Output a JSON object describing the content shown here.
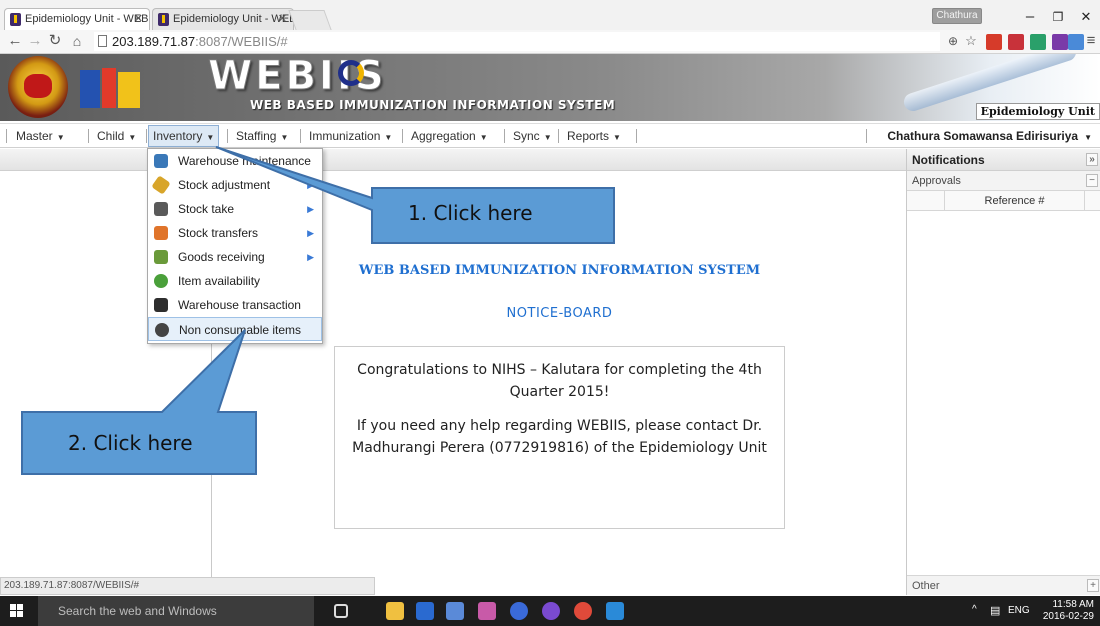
{
  "browser": {
    "tabs": [
      {
        "label": "Epidemiology Unit - WEBII"
      },
      {
        "label": "Epidemiology Unit - WEBI"
      }
    ],
    "user_chip": "Chathura",
    "window_controls": {
      "minimize": "–",
      "maximize": "❐",
      "close": "✕"
    },
    "address": {
      "host": "203.189.71.87",
      "rest": ":8087/WEBIIS/#"
    },
    "status_url": "203.189.71.87:8087/WEBIIS/#"
  },
  "header": {
    "title": "WEBIIS",
    "subtitle": "WEB BASED IMMUNIZATION INFORMATION SYSTEM",
    "unit_label": "Epidemiology Unit"
  },
  "menu": {
    "items": [
      {
        "label": "Master"
      },
      {
        "label": "Child"
      },
      {
        "label": "Inventory"
      },
      {
        "label": "Staffing"
      },
      {
        "label": "Immunization"
      },
      {
        "label": "Aggregation"
      },
      {
        "label": "Sync"
      },
      {
        "label": "Reports"
      }
    ],
    "user": "Chathura Somawansa Edirisuriya"
  },
  "inventory_dropdown": {
    "items": [
      {
        "label": "Warehouse maintenance",
        "icon": "warehouse-icon",
        "color": "#3a78b8",
        "submenu": false
      },
      {
        "label": "Stock adjustment",
        "icon": "brush-icon",
        "color": "#d8a52a",
        "submenu": true
      },
      {
        "label": "Stock take",
        "icon": "stock-take-icon",
        "color": "#5a5a5a",
        "submenu": true
      },
      {
        "label": "Stock transfers",
        "icon": "transfer-icon",
        "color": "#e0742a",
        "submenu": true
      },
      {
        "label": "Goods receiving",
        "icon": "goods-receiving-icon",
        "color": "#6a9a3a",
        "submenu": true
      },
      {
        "label": "Item availability",
        "icon": "item-availability-icon",
        "color": "#4aa03a",
        "submenu": false
      },
      {
        "label": "Warehouse transaction",
        "icon": "warehouse-transaction-icon",
        "color": "#2e2e2e",
        "submenu": false
      },
      {
        "label": "Non consumable items",
        "icon": "non-consumable-icon",
        "color": "#444444",
        "submenu": false
      }
    ]
  },
  "callouts": {
    "first": "1. Click here",
    "second": "2. Click here"
  },
  "content": {
    "title": "WEB BASED IMMUNIZATION INFORMATION SYSTEM",
    "notice_heading": "NOTICE-BOARD",
    "notice_line1": "Congratulations to NIHS – Kalutara for completing the 4th Quarter 2015!",
    "notice_line2": "If you need any help regarding WEBIIS, please contact Dr. Madhurangi Perera (0772919816) of the Epidemiology Unit"
  },
  "notifications": {
    "title": "Notifications",
    "collapse": "»",
    "section": "Approvals",
    "section_toggle": "−",
    "column": "Reference #",
    "other": "Other",
    "other_toggle": "+"
  },
  "taskbar": {
    "search": "Search the web and Windows",
    "lang": "ENG",
    "time": "11:58 AM",
    "date": "2016-02-29"
  },
  "colors": {
    "accent_blue": "#1f6fd0",
    "callout_fill": "#5b9bd5",
    "callout_stroke": "#3e6fa8"
  }
}
